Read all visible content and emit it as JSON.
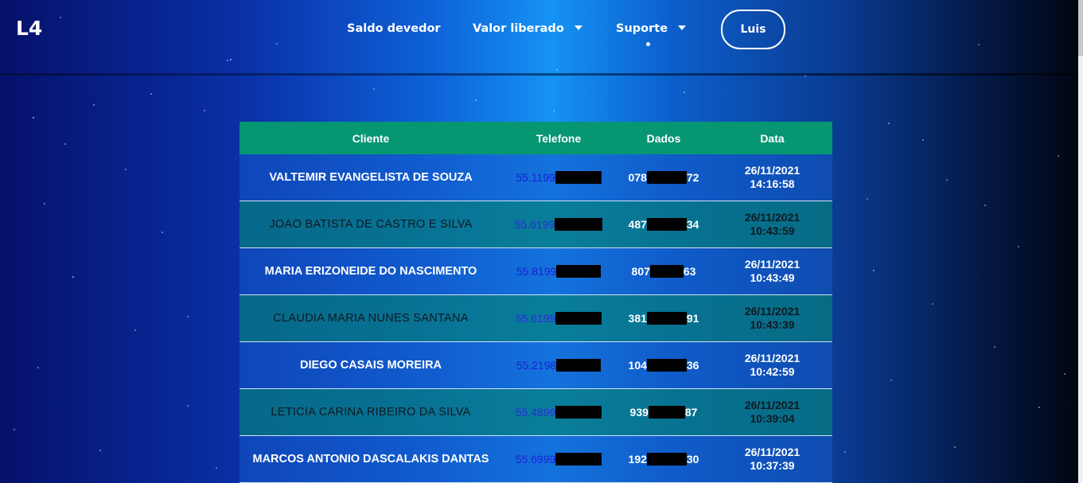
{
  "header": {
    "logo": "L4",
    "nav": {
      "saldo": "Saldo devedor",
      "valor": "Valor liberado",
      "suporte": "Suporte"
    },
    "user": "Luis"
  },
  "table": {
    "columns": [
      "Cliente",
      "Telefone",
      "Dados",
      "Data"
    ],
    "rows": [
      {
        "cliente": "VALTEMIR EVANGELISTA DE SOUZA",
        "tel": "55.1199",
        "dados_start": "078",
        "dados_end": "72",
        "date": "26/11/2021",
        "time": "14:16:58"
      },
      {
        "cliente": "JOAO BATISTA DE CASTRO E SILVA",
        "tel": "55.6199",
        "dados_start": "487",
        "dados_end": "34",
        "date": "26/11/2021",
        "time": "10:43:59"
      },
      {
        "cliente": "MARIA ERIZONEIDE DO NASCIMENTO",
        "tel": "55.8199",
        "dados_start": "807",
        "dados_end": "63",
        "date": "26/11/2021",
        "time": "10:43:49"
      },
      {
        "cliente": "CLAUDIA MARIA NUNES SANTANA",
        "tel": "55.6199",
        "dados_start": "381",
        "dados_end": "91",
        "date": "26/11/2021",
        "time": "10:43:39"
      },
      {
        "cliente": "DIEGO CASAIS MOREIRA",
        "tel": "55.2198",
        "dados_start": "104",
        "dados_end": "36",
        "date": "26/11/2021",
        "time": "10:42:59"
      },
      {
        "cliente": "LETICIA CARINA RIBEIRO DA SILVA",
        "tel": "55.4899",
        "dados_start": "939",
        "dados_end": "87",
        "date": "26/11/2021",
        "time": "10:39:04"
      },
      {
        "cliente": "MARCOS ANTONIO DASCALAKIS DANTAS",
        "tel": "55.6999",
        "dados_start": "192",
        "dados_end": "30",
        "date": "26/11/2021",
        "time": "10:37:39"
      }
    ]
  }
}
